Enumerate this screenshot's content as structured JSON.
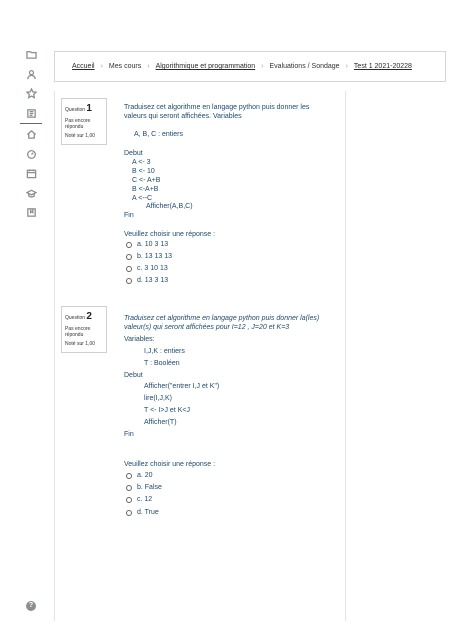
{
  "breadcrumb": {
    "items": [
      "Accueil",
      "Mes cours",
      "Algorithmique et programmation",
      "Evaluations / Sondage",
      "Test 1 2021-20228"
    ]
  },
  "q1": {
    "label": "Question",
    "number": "1",
    "status": "Pas encore répondu",
    "mark": "Noté sur 1,00",
    "prompt_line1": "Traduisez cet algorithme en langage python puis donner les",
    "prompt_line2": "valeurs qui seront affichées. Variables",
    "code": [
      "A, B, C : entiers",
      "Debut",
      "A <- 3",
      "B <- 10",
      "C <- A+B",
      "B <-A+B",
      "A <--C",
      "Afficher(A,B,C)",
      "Fin"
    ],
    "choose": "Veuillez choisir une réponse :",
    "options": [
      "a. 10 3 13",
      "b. 13 13 13",
      "c. 3 10 13",
      "d. 13 3 13"
    ]
  },
  "q2": {
    "label": "Question",
    "number": "2",
    "status": "Pas encore répondu",
    "mark": "Noté sur 1,00",
    "prompt_line1": "Traduisez cet algorithme en langage python puis donner la(les)",
    "prompt_line2": "valeur(s) qui seront affichées pour I=12 , J=20 et K=3",
    "code": [
      "Variables:",
      "I,J,K : entiers",
      "T : Booléen",
      "Debut",
      "Afficher(\"entrer I,J et K\")",
      "lire(I,J,K)",
      "T <- I>J et K<J",
      "Afficher(T)",
      "Fin"
    ],
    "choose": "Veuillez choisir une réponse :",
    "options": [
      "a. 20",
      "b. False",
      "c. 12",
      "d. True"
    ]
  },
  "rail_icons": [
    "folder-icon",
    "user-icon",
    "star-icon",
    "book-icon",
    "home-icon",
    "dashboard-icon",
    "calendar-icon",
    "graduation-icon",
    "bookmark-icon"
  ],
  "help": "?"
}
